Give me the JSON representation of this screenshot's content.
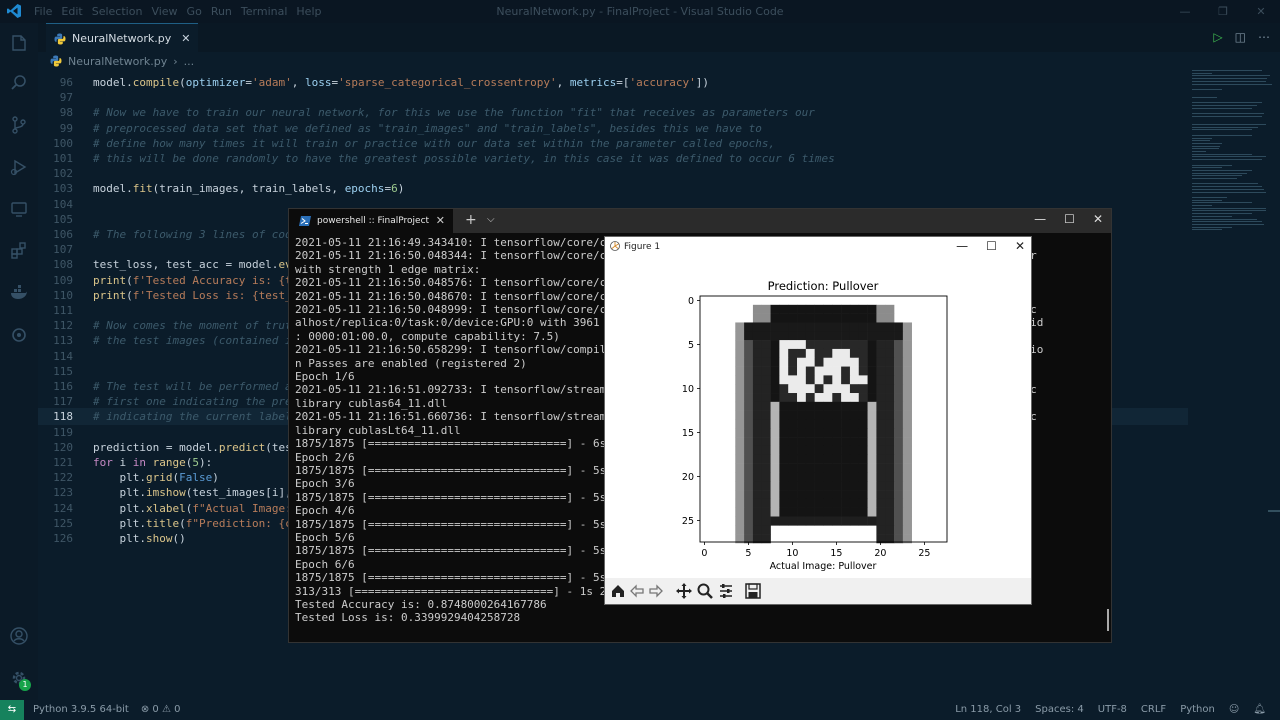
{
  "app": {
    "window_title": "NeuralNetwork.py - FinalProject - Visual Studio Code",
    "menus": [
      "File",
      "Edit",
      "Selection",
      "View",
      "Go",
      "Run",
      "Terminal",
      "Help"
    ],
    "window_controls": [
      "—",
      "❐",
      "✕"
    ]
  },
  "editor": {
    "tab_label": "NeuralNetwork.py",
    "breadcrumb_file": "NeuralNetwork.py",
    "breadcrumb_rest": "...",
    "current_line": 118,
    "lines": [
      {
        "n": "96",
        "html": "model.<span class='fn'>compile</span>(<span class='var'>optimizer</span>=<span class='str'>'adam'</span>, <span class='var'>loss</span>=<span class='str'>'sparse_categorical_crossentropy'</span>, <span class='var'>metrics</span>=[<span class='str'>'accuracy'</span>])"
      },
      {
        "n": "97",
        "html": ""
      },
      {
        "n": "98",
        "html": "<span class='cmt'># Now we have to train our neural network, for this we use the function \"fit\" that receives as parameters our</span>"
      },
      {
        "n": "99",
        "html": "<span class='cmt'># preprocessed data set that we defined as \"train_images\" and \"train_labels\", besides this we have to</span>"
      },
      {
        "n": "100",
        "html": "<span class='cmt'># define how many times it will train or practice with our data set within the parameter called epochs,</span>"
      },
      {
        "n": "101",
        "html": "<span class='cmt'># this will be done randomly to have the greatest possible variety, in this case it was defined to occur 6 times</span>"
      },
      {
        "n": "102",
        "html": ""
      },
      {
        "n": "103",
        "html": "model.<span class='fn'>fit</span>(train_images, train_labels, <span class='var'>epochs</span>=<span class='num'>6</span>)"
      },
      {
        "n": "104",
        "html": ""
      },
      {
        "n": "105",
        "html": ""
      },
      {
        "n": "106",
        "html": "<span class='cmt'># The following 3 lines of code</span>"
      },
      {
        "n": "107",
        "html": ""
      },
      {
        "n": "108",
        "html": "test_loss, test_acc = model.<span class='fn'>eval</span>"
      },
      {
        "n": "109",
        "html": "<span class='fn'>print</span>(<span class='str'>f'Tested Accuracy is: {tes</span>"
      },
      {
        "n": "110",
        "html": "<span class='fn'>print</span>(<span class='str'>f'Tested Loss is: {test_lo</span>"
      },
      {
        "n": "111",
        "html": ""
      },
      {
        "n": "112",
        "html": "<span class='cmt'># Now comes the moment of truth</span>"
      },
      {
        "n": "113",
        "html": "<span class='cmt'># the test images (contained in</span>"
      },
      {
        "n": "114",
        "html": ""
      },
      {
        "n": "115",
        "html": ""
      },
      {
        "n": "116",
        "html": "<span class='cmt'># The test will be performed aga</span>"
      },
      {
        "n": "117",
        "html": "<span class='cmt'># first one indicating the predi</span>"
      },
      {
        "n": "118",
        "html": "<span class='cmt'># indicating the current label c</span>"
      },
      {
        "n": "119",
        "html": ""
      },
      {
        "n": "120",
        "html": "prediction = model.<span class='fn'>predict</span>(test_"
      },
      {
        "n": "121",
        "html": "<span class='kw'>for</span> i <span class='kw'>in</span> <span class='fn'>range</span>(<span class='num'>5</span>):"
      },
      {
        "n": "122",
        "html": "    plt.<span class='fn'>grid</span>(<span class='bool'>False</span>)"
      },
      {
        "n": "123",
        "html": "    plt.<span class='fn'>imshow</span>(test_images[i], c"
      },
      {
        "n": "124",
        "html": "    plt.<span class='fn'>xlabel</span>(<span class='str'>f\"Actual Image: {</span>"
      },
      {
        "n": "125",
        "html": "    plt.<span class='fn'>title</span>(<span class='str'>f\"Prediction: {cla</span>"
      },
      {
        "n": "126",
        "html": "    plt.<span class='fn'>show</span>()"
      }
    ]
  },
  "status": {
    "remote": "⇆",
    "python": "Python 3.9.5 64-bit",
    "problems": "⊗ 0 ⚠ 0",
    "position": "Ln 118, Col 3",
    "spaces": "Spaces: 4",
    "encoding": "UTF-8",
    "eol": "CRLF",
    "language": "Python",
    "badge": "1"
  },
  "terminal": {
    "tab_label": "powershell :: FinalProject",
    "plus": "+",
    "dropdown": "⌵",
    "controls": [
      "—",
      "☐",
      "✕"
    ],
    "output": [
      "2021-05-11 21:16:49.343410: I tensorflow/core/c                                                        : 0",
      "2021-05-11 21:16:50.048344: I tensorflow/core/c                                                        nExecutor",
      "with strength 1 edge matrix:",
      "2021-05-11 21:16:50.048576: I tensorflow/core/c",
      "2021-05-11 21:16:50.048670: I tensorflow/core/c",
      "2021-05-11 21:16:50.048999: I tensorflow/core/c                                                        (/job:loc",
      "alhost/replica:0/task:0/device:GPU:0 with 3961                                                         oci bus id",
      ": 0000:01:00.0, compute capability: 7.5)",
      "2021-05-11 21:16:50.658299: I tensorflow/compil                                                        ptimizatio",
      "n Passes are enabled (registered 2)",
      "Epoch 1/6",
      "2021-05-11 21:16:51.092733: I tensorflow/stream                                                        d dynamic",
      "library cublas64_11.dll",
      "2021-05-11 21:16:51.660736: I tensorflow/stream                                                        d dynamic",
      "library cublasLt64_11.dll",
      "1875/1875 [==============================] - 6s",
      "Epoch 2/6",
      "1875/1875 [==============================] - 5s",
      "Epoch 3/6",
      "1875/1875 [==============================] - 5s",
      "Epoch 4/6",
      "1875/1875 [==============================] - 5s",
      "Epoch 5/6",
      "1875/1875 [==============================] - 5s",
      "Epoch 6/6",
      "1875/1875 [==============================] - 5s",
      "313/313 [==============================] - 1s 2",
      "Tested Accuracy is: 0.8748000264167786",
      "Tested Loss is: 0.3399929404258728"
    ]
  },
  "figure": {
    "window_title": "Figure 1",
    "controls": [
      "—",
      "☐",
      "✕"
    ],
    "plot_title": "Prediction: Pullover",
    "xlabel": "Actual Image: Pullover",
    "xticks": [
      "0",
      "5",
      "10",
      "15",
      "20",
      "25"
    ],
    "yticks": [
      "0",
      "5",
      "10",
      "15",
      "20",
      "25"
    ],
    "toolbar": [
      "home-icon",
      "back-icon",
      "forward-icon",
      "pan-icon",
      "zoom-icon",
      "configure-icon",
      "save-icon"
    ]
  }
}
